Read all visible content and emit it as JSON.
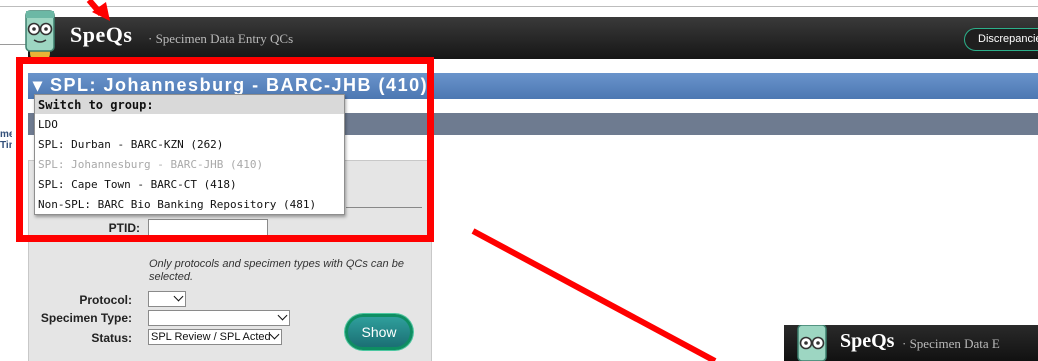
{
  "app": {
    "brand": "SpeQs",
    "tagline": "· Specimen Data Entry QCs",
    "discrepancies_button": "Discrepancies"
  },
  "left_edge_labels": [
    "me",
    "Tim"
  ],
  "group_bar": {
    "title": "SPL: Johannesburg - BARC-JHB (410)"
  },
  "group_menu": {
    "header": "Switch to group:",
    "items": [
      {
        "label": "LDO",
        "disabled": false
      },
      {
        "label": "SPL: Durban - BARC-KZN (262)",
        "disabled": false
      },
      {
        "label": "SPL: Johannesburg - BARC-JHB (410)",
        "disabled": true
      },
      {
        "label": "SPL: Cape Town - BARC-CT (418)",
        "disabled": false
      },
      {
        "label": "Non-SPL: BARC Bio Banking Repository (481)",
        "disabled": false
      }
    ]
  },
  "form": {
    "ptid_label": "PTID:",
    "ptid_value": "",
    "note": "Only protocols and specimen types with QCs can be selected.",
    "protocol_label": "Protocol:",
    "protocol_value": "",
    "specimen_type_label": "Specimen Type:",
    "specimen_type_value": "",
    "status_label": "Status:",
    "status_value": "SPL Review / SPL Acted",
    "show_button": "Show"
  },
  "lower_logo": {
    "brand": "SpeQs",
    "tagline": "· Specimen Data E"
  },
  "colors": {
    "annotation_red": "#ff0000",
    "group_bar_blue": "#5b86c0",
    "header_dark": "#222222",
    "button_green": "#0e8e62"
  }
}
